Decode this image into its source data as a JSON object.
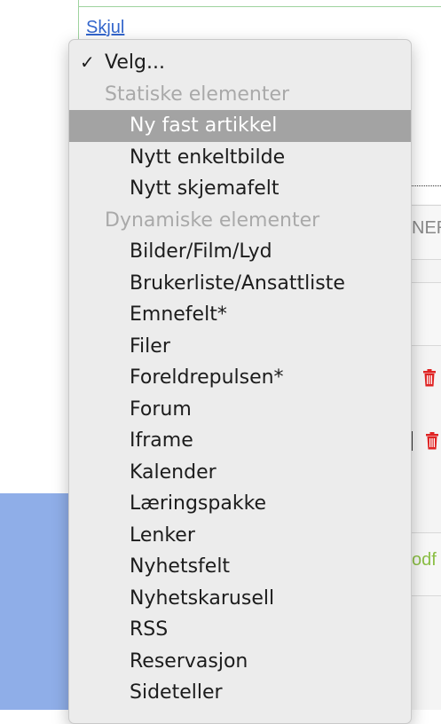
{
  "page": {
    "link_label": "Skjul",
    "fragment_1": "NER",
    "fragment_2": "odf"
  },
  "dropdown": {
    "selected_mark": "✓",
    "items": [
      {
        "label": "Velg...",
        "kind": "option",
        "selected": true
      },
      {
        "label": "Statiske elementer",
        "kind": "group"
      },
      {
        "label": "Ny fast artikkel",
        "kind": "option",
        "highlighted": true
      },
      {
        "label": "Nytt enkeltbilde",
        "kind": "option"
      },
      {
        "label": "Nytt skjemafelt",
        "kind": "option"
      },
      {
        "label": "Dynamiske elementer",
        "kind": "group"
      },
      {
        "label": "Bilder/Film/Lyd",
        "kind": "option"
      },
      {
        "label": "Brukerliste/Ansattliste",
        "kind": "option"
      },
      {
        "label": "Emnefelt*",
        "kind": "option"
      },
      {
        "label": "Filer",
        "kind": "option"
      },
      {
        "label": "Foreldrepulsen*",
        "kind": "option"
      },
      {
        "label": "Forum",
        "kind": "option"
      },
      {
        "label": "Iframe",
        "kind": "option"
      },
      {
        "label": "Kalender",
        "kind": "option"
      },
      {
        "label": "Læringspakke",
        "kind": "option"
      },
      {
        "label": "Lenker",
        "kind": "option"
      },
      {
        "label": "Nyhetsfelt",
        "kind": "option"
      },
      {
        "label": "Nyhetskarusell",
        "kind": "option"
      },
      {
        "label": "RSS",
        "kind": "option"
      },
      {
        "label": "Reservasjon",
        "kind": "option"
      },
      {
        "label": "Sideteller",
        "kind": "option"
      }
    ]
  },
  "colors": {
    "highlight": "#a3a3a3",
    "group_label": "#a9a9a9",
    "link": "#3366cc",
    "trash": "#e02424",
    "pdf_text": "#8bbf45"
  }
}
